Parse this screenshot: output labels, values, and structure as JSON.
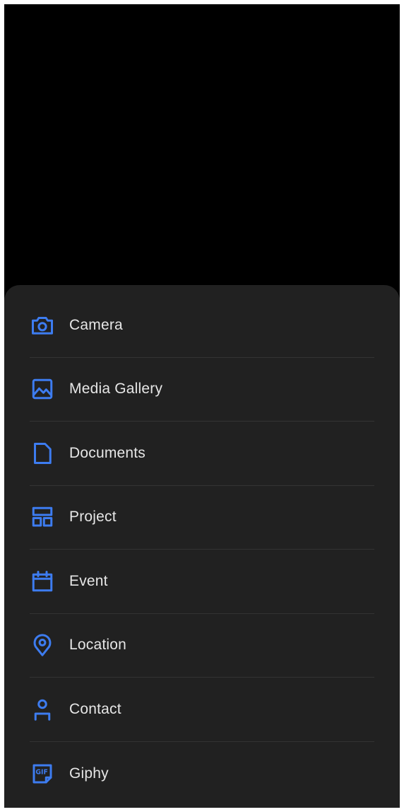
{
  "menu": {
    "items": [
      {
        "label": "Camera",
        "icon": "camera-icon"
      },
      {
        "label": "Media Gallery",
        "icon": "image-icon"
      },
      {
        "label": "Documents",
        "icon": "document-icon"
      },
      {
        "label": "Project",
        "icon": "layout-icon"
      },
      {
        "label": "Event",
        "icon": "calendar-icon"
      },
      {
        "label": "Location",
        "icon": "location-pin-icon"
      },
      {
        "label": "Contact",
        "icon": "person-icon"
      },
      {
        "label": "Giphy",
        "icon": "gif-icon"
      }
    ]
  },
  "icons": {
    "gif_text": "GIF"
  },
  "colors": {
    "accent": "#3d7cf0",
    "sheet_background": "#212121",
    "backdrop": "#000000",
    "text": "#e6e6e6",
    "divider": "#333333"
  }
}
